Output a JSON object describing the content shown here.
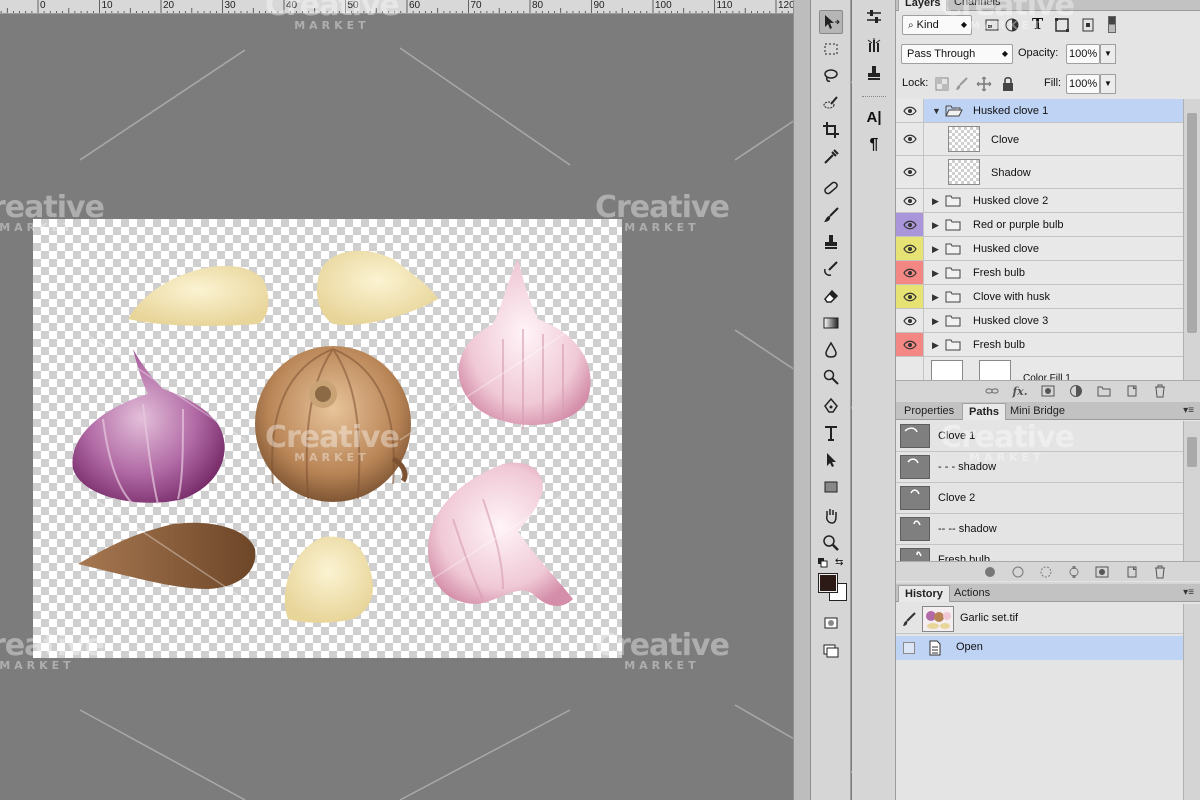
{
  "ruler": {
    "numbers": [
      "0",
      "10",
      "20",
      "30",
      "40",
      "50",
      "60",
      "70",
      "80",
      "90",
      "100",
      "110",
      "120"
    ]
  },
  "document": {
    "name": "Garlic set.tif"
  },
  "tools_panel": {
    "mini_panel": {
      "paragraph_glyph": "¶",
      "character_glyph": "A|"
    }
  },
  "layers_panel": {
    "tabs": [
      "Layers",
      "Channels"
    ],
    "filter_kind": "Kind",
    "blend_mode": "Pass Through",
    "opacity_label": "Opacity:",
    "opacity_value": "100%",
    "lock_label": "Lock:",
    "fill_label": "Fill:",
    "fill_value": "100%",
    "layers": [
      {
        "name": "Husked clove 1",
        "type": "group-open",
        "color": "#e8e8e8",
        "selected": true
      },
      {
        "name": "Clove",
        "type": "layer",
        "color": "#e8e8e8"
      },
      {
        "name": "Shadow",
        "type": "layer",
        "color": "#e8e8e8"
      },
      {
        "name": "Husked clove 2",
        "type": "group",
        "color": "#e8e8e8"
      },
      {
        "name": "Red or purple bulb",
        "type": "group",
        "color": "#a995d9"
      },
      {
        "name": "Husked clove",
        "type": "group",
        "color": "#e6e274"
      },
      {
        "name": "Fresh bulb",
        "type": "group",
        "color": "#f28783"
      },
      {
        "name": "Clove with husk",
        "type": "group",
        "color": "#e6e274"
      },
      {
        "name": "Husked clove 3",
        "type": "group",
        "color": "#e8e8e8"
      },
      {
        "name": "Fresh bulb",
        "type": "group",
        "color": "#f28783"
      },
      {
        "name": "Color Fill 1",
        "type": "fill",
        "color": "#e8e8e8"
      }
    ]
  },
  "paths_panel": {
    "tabs": [
      "Properties",
      "Paths",
      "Mini Bridge"
    ],
    "paths": [
      "Clove 1",
      "- - - shadow",
      "Clove 2",
      "-- -- shadow",
      "Fresh bulb"
    ]
  },
  "history_panel": {
    "tabs": [
      "History",
      "Actions"
    ],
    "snapshot": "Garlic set.tif",
    "items": [
      "Open"
    ]
  },
  "watermark": {
    "brand": "Creative",
    "sub": "MARKET"
  },
  "colors": {
    "foreground": "#2b1a16",
    "background": "#ffffff",
    "selection": "#bfd3f5"
  }
}
